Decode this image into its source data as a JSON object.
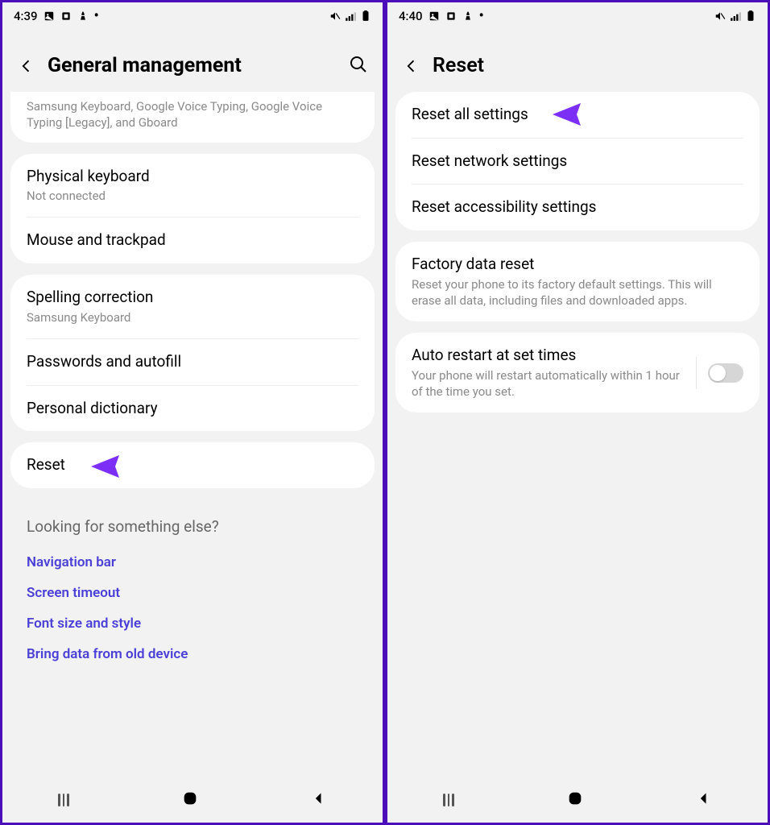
{
  "left": {
    "status": {
      "time": "4:39"
    },
    "header": {
      "title": "General management"
    },
    "keyboard_list_sub": "Samsung Keyboard, Google Voice Typing, Google Voice Typing [Legacy], and Gboard",
    "physical_keyboard": {
      "title": "Physical keyboard",
      "sub": "Not connected"
    },
    "mouse_trackpad": "Mouse and trackpad",
    "spelling": {
      "title": "Spelling correction",
      "sub": "Samsung Keyboard"
    },
    "passwords": "Passwords and autofill",
    "personal_dict": "Personal dictionary",
    "reset": "Reset",
    "looking": {
      "title": "Looking for something else?",
      "links": [
        "Navigation bar",
        "Screen timeout",
        "Font size and style",
        "Bring data from old device"
      ]
    }
  },
  "right": {
    "status": {
      "time": "4:40"
    },
    "header": {
      "title": "Reset"
    },
    "reset_all": "Reset all settings",
    "reset_network": "Reset network settings",
    "reset_accessibility": "Reset accessibility settings",
    "factory": {
      "title": "Factory data reset",
      "sub": "Reset your phone to its factory default settings. This will erase all data, including files and downloaded apps."
    },
    "auto_restart": {
      "title": "Auto restart at set times",
      "sub": "Your phone will restart automatically within 1 hour of the time you set."
    }
  }
}
